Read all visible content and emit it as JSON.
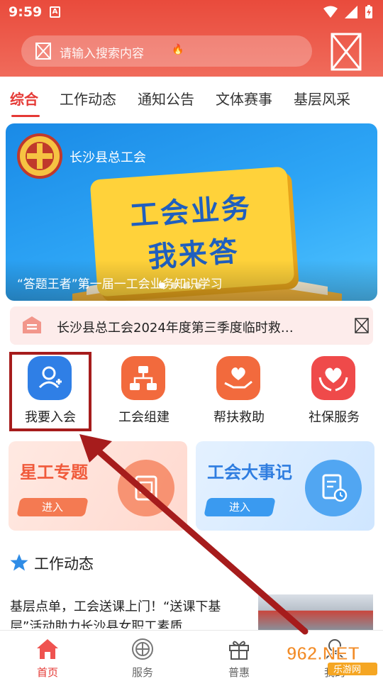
{
  "status_bar": {
    "time": "9:59",
    "indicator": "A"
  },
  "search": {
    "placeholder": "请输入搜索内容"
  },
  "tabs": [
    {
      "label": "综合",
      "active": true
    },
    {
      "label": "工作动态"
    },
    {
      "label": "通知公告"
    },
    {
      "label": "文体赛事"
    },
    {
      "label": "基层风采"
    }
  ],
  "banner": {
    "org_name": "长沙县总工会",
    "headline_line1": "工会业务",
    "headline_line2": "我来答",
    "caption": "“答题王者”第一届一工会业务知识学习",
    "slides": 4,
    "active_slide": 1
  },
  "notice": {
    "text": "长沙县总工会2024年度第三季度临时救…"
  },
  "services": [
    {
      "label": "我要入会",
      "icon": "user-add-icon",
      "color": "#2f7fe6"
    },
    {
      "label": "工会组建",
      "icon": "org-chart-icon",
      "color": "#f26a3d"
    },
    {
      "label": "帮扶救助",
      "icon": "heart-hand-icon",
      "color": "#f26a3d"
    },
    {
      "label": "社保服务",
      "icon": "heart-hands-icon",
      "color": "#ef4a4a"
    }
  ],
  "cards": [
    {
      "title": "星工专题",
      "button": "进入",
      "icon": "book-icon"
    },
    {
      "title": "工会大事记",
      "button": "进入",
      "icon": "clock-document-icon"
    }
  ],
  "section": {
    "title": "工作动态",
    "icon": "star-icon"
  },
  "news": {
    "text": "基层点单，工会送课上门！“送课下基层”活动助力长沙县女职工素质…"
  },
  "bottom_nav": [
    {
      "label": "首页",
      "icon": "home-icon",
      "active": true
    },
    {
      "label": "服务",
      "icon": "union-emblem-icon"
    },
    {
      "label": "普惠",
      "icon": "gift-icon"
    },
    {
      "label": "我的",
      "icon": "profile-icon"
    }
  ],
  "watermark": {
    "text": "962.NET",
    "subtext": "乐游网"
  },
  "colors": {
    "brand_red": "#e53935",
    "header_red": "#e94b3c",
    "annotation": "#a61c1c"
  }
}
